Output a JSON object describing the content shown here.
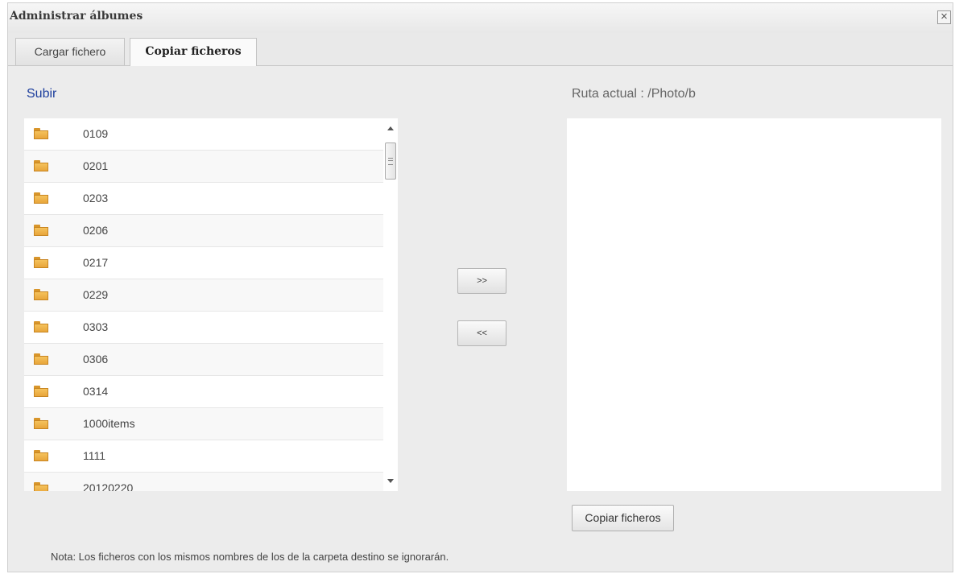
{
  "dialog": {
    "title": "Administrar álbumes",
    "close_glyph": "×"
  },
  "tabs": [
    {
      "label": "Cargar fichero",
      "active": false
    },
    {
      "label": "Copiar ficheros",
      "active": true
    }
  ],
  "source": {
    "up_link": "Subir",
    "folders": [
      {
        "name": "0109",
        "icon": "folder-icon"
      },
      {
        "name": "0201",
        "icon": "folder-icon"
      },
      {
        "name": "0203",
        "icon": "folder-icon"
      },
      {
        "name": "0206",
        "icon": "folder-icon"
      },
      {
        "name": "0217",
        "icon": "folder-icon"
      },
      {
        "name": "0229",
        "icon": "folder-icon"
      },
      {
        "name": "0303",
        "icon": "folder-icon"
      },
      {
        "name": "0306",
        "icon": "folder-icon"
      },
      {
        "name": "0314",
        "icon": "folder-icon"
      },
      {
        "name": "1000items",
        "icon": "folder-icon"
      },
      {
        "name": "1111",
        "icon": "folder-icon"
      },
      {
        "name": "20120220",
        "icon": "folder-icon"
      }
    ]
  },
  "transfer": {
    "add_label": ">>",
    "remove_label": "<<"
  },
  "destination": {
    "current_path": "Ruta actual : /Photo/b",
    "copy_button": "Copiar ficheros"
  },
  "note": "Nota: Los ficheros con los mismos nombres de los de la carpeta destino se ignorarán.",
  "colors": {
    "link": "#1a3c9c",
    "folder": "#f0b44a"
  }
}
